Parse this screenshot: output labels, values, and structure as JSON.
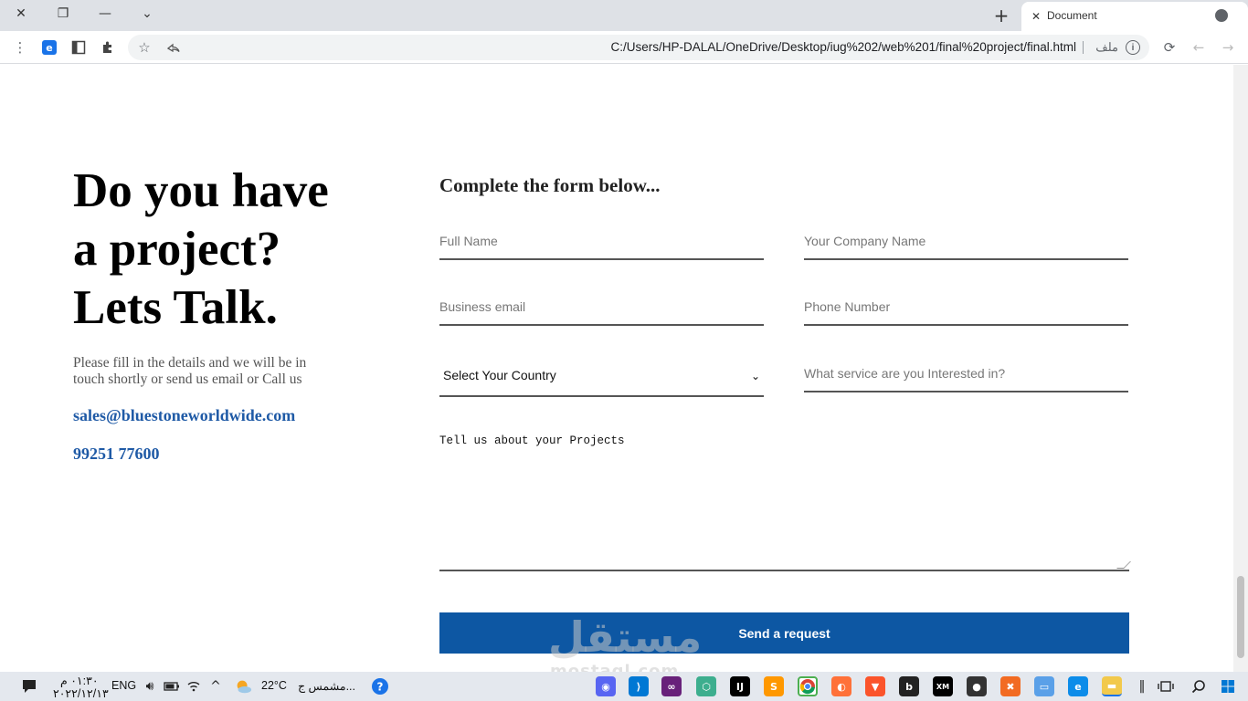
{
  "browser": {
    "tab_title": "Document",
    "url": "C:/Users/HP-DALAL/OneDrive/Desktop/iug%202/web%201/final%20project/final.html",
    "url_prefix": "ملف"
  },
  "hero": {
    "headline_line1": "Do you have",
    "headline_line2": "a project?",
    "headline_line3": "Lets Talk.",
    "intro": "Please fill in the details and we will be in touch shortly or send us email or Call us",
    "email": "sales@bluestoneworldwide.com",
    "phone": "99251 77600"
  },
  "form": {
    "title": "Complete the form below...",
    "full_name_placeholder": "Full Name",
    "company_placeholder": "Your Company Name",
    "email_placeholder": "Business email",
    "phone_placeholder": "Phone Number",
    "country_selected": "Select Your Country",
    "service_placeholder": "What service are you Interested in?",
    "project_placeholder": "Tell us about your Projects",
    "submit_label": "Send a request"
  },
  "watermark": {
    "main": "مستقل",
    "sub": "mostaql.com"
  },
  "taskbar": {
    "time": "٠١:٣٠ م",
    "date": "٢٠٢٢/١٢/١٣",
    "language": "ENG",
    "temperature": "22°C",
    "weather": "مشمس ج..."
  },
  "colors": {
    "accent": "#0d57a3",
    "link": "#1f5aa6"
  }
}
